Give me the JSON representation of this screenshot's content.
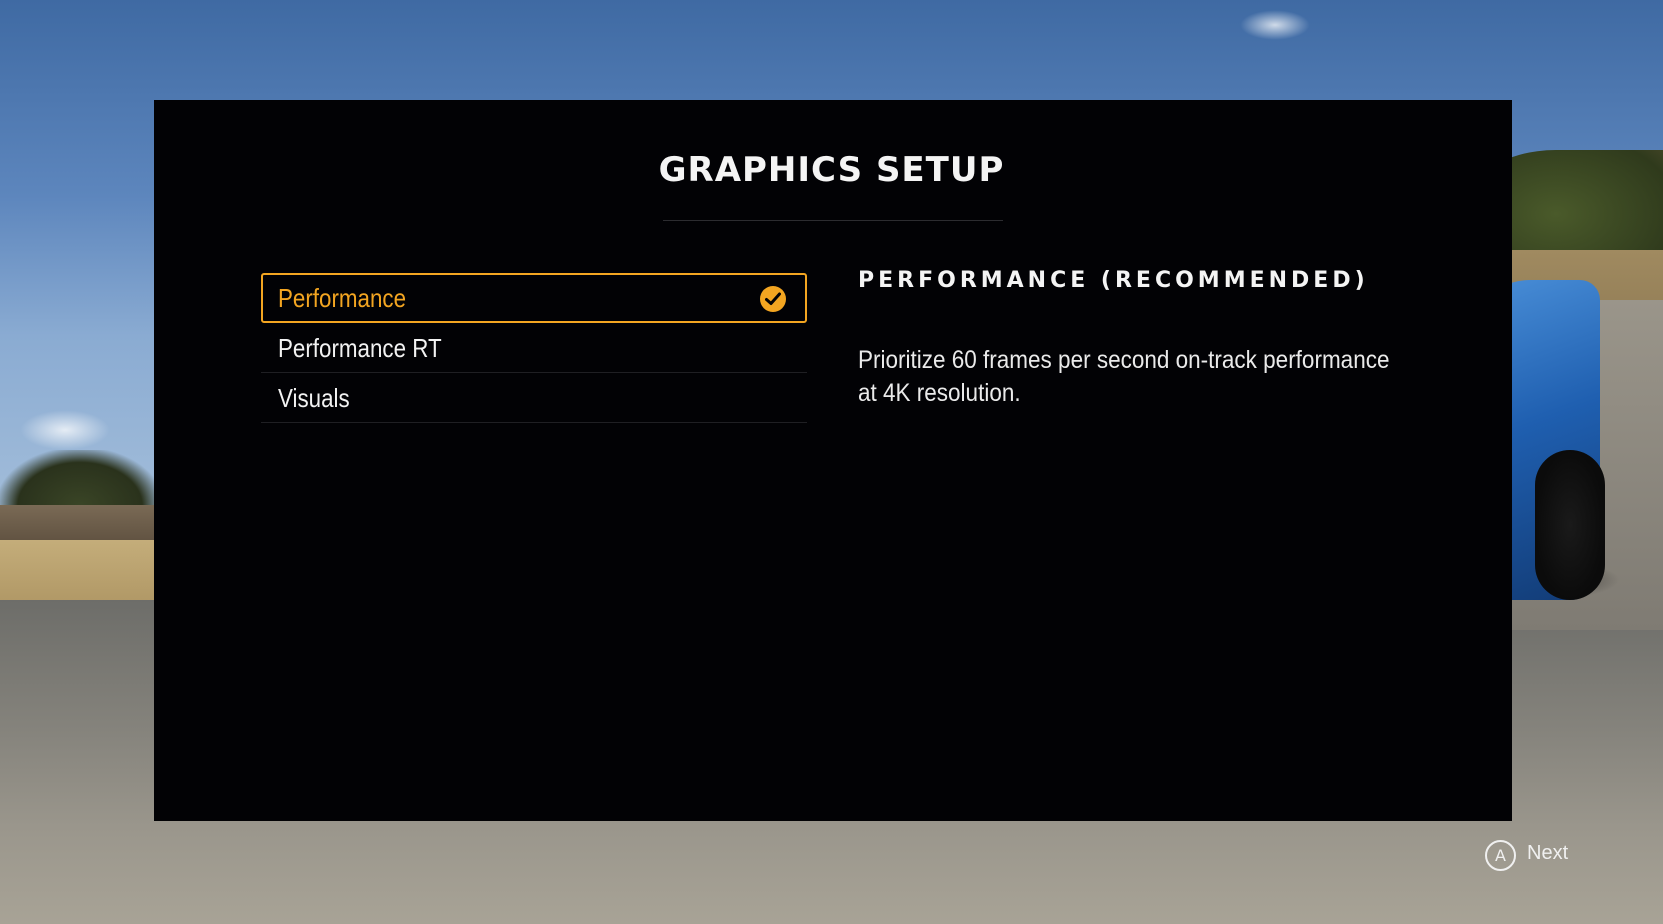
{
  "dialog": {
    "title": "GRAPHICS SETUP",
    "options": [
      {
        "label": "Performance",
        "selected": true
      },
      {
        "label": "Performance RT",
        "selected": false
      },
      {
        "label": "Visuals",
        "selected": false
      }
    ],
    "description": {
      "heading": "PERFORMANCE (RECOMMENDED)",
      "body": "Prioritize 60 frames per second on-track performance at 4K resolution."
    }
  },
  "footer": {
    "button_glyph": "A",
    "next_label": "Next"
  },
  "colors": {
    "accent": "#f3a521",
    "panel": "#020205"
  },
  "icons": {
    "selected_check": "check-circle-icon",
    "controller_button": "a-button-icon"
  }
}
